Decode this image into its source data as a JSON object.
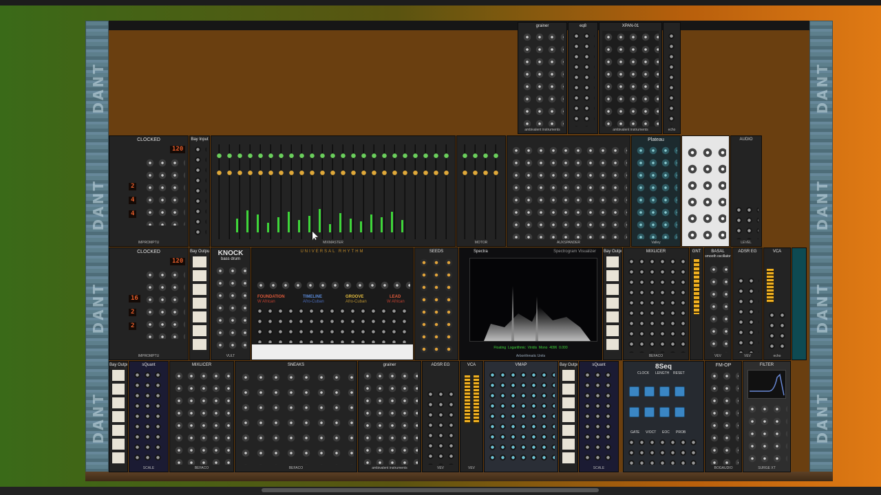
{
  "window": {
    "scroll_position": 0.36
  },
  "rack": {
    "rail_label": "DANT",
    "rows": [
      {
        "row": "top",
        "modules": [
          {
            "id": "grainer-top",
            "title": "grainer",
            "subtitle": "",
            "foot": "ambivalent instruments"
          },
          {
            "id": "xpan-top",
            "title": "XPAN-01",
            "subtitle": "",
            "foot": "ambivalent instruments"
          },
          {
            "id": "eq8",
            "title": "eq8",
            "subtitle": "",
            "foot": ""
          },
          {
            "id": "misc-right",
            "title": "",
            "subtitle": "",
            "foot": "echo"
          }
        ]
      },
      {
        "row": "1",
        "modules": [
          {
            "id": "clocked-1",
            "title": "CLOCKED",
            "subtitle": "",
            "foot": "IMPROMPTU",
            "readouts": [
              "120",
              "2",
              "4",
              "4"
            ]
          },
          {
            "id": "bay-input-1",
            "title": "Bay Input",
            "subtitle": "",
            "foot": ""
          },
          {
            "id": "mixmaster",
            "title": "",
            "subtitle": "",
            "foot": "MIXMASTER"
          },
          {
            "id": "mixmaster-aux",
            "title": "",
            "subtitle": "",
            "foot": "MOTOR"
          },
          {
            "id": "auxspander",
            "title": "",
            "subtitle": "",
            "foot": "AUXSPANDER"
          },
          {
            "id": "plateau",
            "title": "Plateau",
            "subtitle": "",
            "foot": "Valley"
          },
          {
            "id": "mix-white",
            "title": "",
            "subtitle": "",
            "foot": ""
          },
          {
            "id": "audio",
            "title": "AUDIO",
            "subtitle": "",
            "foot": "LEVEL"
          }
        ]
      },
      {
        "row": "2",
        "modules": [
          {
            "id": "clocked-2",
            "title": "CLOCKED",
            "subtitle": "",
            "foot": "IMPROMPTU",
            "readouts": [
              "120",
              "16",
              "2",
              "2"
            ]
          },
          {
            "id": "bay-output-2",
            "title": "Bay Output",
            "subtitle": "",
            "foot": ""
          },
          {
            "id": "knock",
            "title": "KNOCK",
            "subtitle": "bass drum",
            "foot": "VULT"
          },
          {
            "id": "universal-rhythm",
            "title": "UNIVERSAL RHYTHM",
            "subtitle": "",
            "foot": "",
            "parts": [
              {
                "label": "FOUNDATION",
                "sub": "W African"
              },
              {
                "label": "TIMELINE",
                "sub": "Afro-Cuban"
              },
              {
                "label": "GROOVE",
                "sub": "Afro-Cuban"
              },
              {
                "label": "LEAD",
                "sub": "W African"
              }
            ]
          },
          {
            "id": "seeds",
            "title": "SEEDS",
            "subtitle": "",
            "foot": ""
          },
          {
            "id": "spectra",
            "title": "Spectra",
            "subtitle": "Spectrogram Visualizer",
            "foot": "Arborithmatic Units",
            "readouts": [
              "Floating",
              "Logarithmic",
              "Viridis",
              "Mono",
              "4096",
              "0.000"
            ]
          },
          {
            "id": "bay-output-2b",
            "title": "Bay Output",
            "subtitle": "",
            "foot": ""
          },
          {
            "id": "mixlicer-2",
            "title": "MIXLICER",
            "subtitle": "",
            "foot": "BEFACO"
          },
          {
            "id": "gnt",
            "title": "GNT",
            "subtitle": "",
            "foot": ""
          },
          {
            "id": "basal",
            "title": "BASAL",
            "subtitle": "smooth oscillator",
            "foot": "VEV"
          },
          {
            "id": "adsr-2",
            "title": "ADSR EG",
            "subtitle": "",
            "foot": "VEV"
          },
          {
            "id": "vca-2",
            "title": "VCA",
            "subtitle": "",
            "foot": "echo"
          }
        ]
      },
      {
        "row": "3",
        "modules": [
          {
            "id": "bay-output-3",
            "title": "Bay Output",
            "subtitle": "",
            "foot": ""
          },
          {
            "id": "squant-1",
            "title": "sQuant",
            "subtitle": "",
            "foot": "SCALE"
          },
          {
            "id": "mixlicer-3",
            "title": "MIXLICER",
            "subtitle": "",
            "foot": "BEFACO"
          },
          {
            "id": "sneaks",
            "title": "SNEAKS",
            "subtitle": "",
            "foot": "BEFACO"
          },
          {
            "id": "grainer-3",
            "title": "grainer",
            "subtitle": "",
            "foot": "ambivalent instruments"
          },
          {
            "id": "adsr-3",
            "title": "ADSR EG",
            "subtitle": "",
            "foot": "VEV"
          },
          {
            "id": "vca-3",
            "title": "VCA",
            "subtitle": "",
            "foot": "VEV"
          },
          {
            "id": "vmap",
            "title": "VMAP",
            "subtitle": "",
            "foot": ""
          },
          {
            "id": "bay-output-3b",
            "title": "Bay Output",
            "subtitle": "",
            "foot": ""
          },
          {
            "id": "squant-2",
            "title": "sQuant",
            "subtitle": "",
            "foot": "SCALE"
          },
          {
            "id": "8seq",
            "title": "8Seq",
            "subtitle": "",
            "foot": "",
            "labels": [
              "CLOCK",
              "LENGTH",
              "RESET",
              "GATE",
              "V/OCT",
              "EOC",
              "PROB"
            ]
          },
          {
            "id": "fm-op",
            "title": "FM-OP",
            "subtitle": "",
            "foot": "BOGAUDIO"
          },
          {
            "id": "filter",
            "title": "FILTER",
            "subtitle": "",
            "foot": "SURGE XT"
          }
        ]
      }
    ]
  },
  "colors": {
    "background_left": "#3a6a18",
    "background_right": "#e07a14",
    "rail": "#5d7f8c",
    "panel": "#232323",
    "accent_green": "#3fd63a",
    "accent_orange": "#e25c2a",
    "pad_blue": "#3a86c4"
  }
}
